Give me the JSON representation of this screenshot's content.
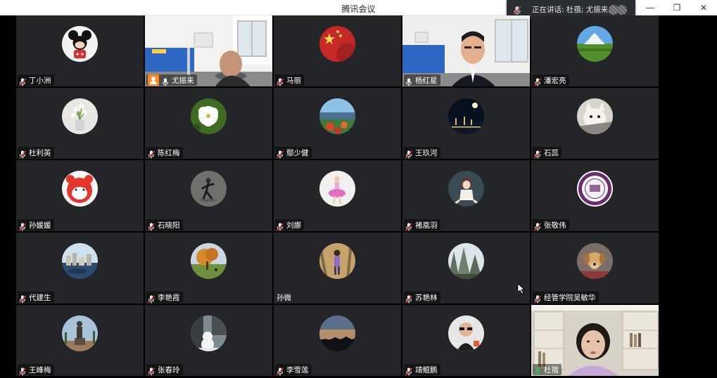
{
  "window": {
    "title": "腾讯会议",
    "speaking_label": "正在讲话: 杜蓓; 尤振来;",
    "controls": {
      "minimize": "—",
      "restore": "❐",
      "close": "✕"
    }
  },
  "colors": {
    "tile_bg": "#242529",
    "speaking_green": "#2fbf55",
    "host_orange": "#ff8a1f",
    "muted_red": "#e53935"
  },
  "participants": [
    {
      "name": "丁小洲",
      "mic": "muted",
      "avatar": "mickey"
    },
    {
      "name": "尤振来",
      "mic": "on",
      "host": true,
      "avatar": "video-room"
    },
    {
      "name": "马丽",
      "mic": "muted",
      "avatar": "flag"
    },
    {
      "name": "杨红星",
      "mic": "on",
      "avatar": "video-man"
    },
    {
      "name": "潘宏亮",
      "mic": "muted",
      "avatar": "mountain"
    },
    {
      "name": "杜利英",
      "mic": "muted",
      "avatar": "flower-vase"
    },
    {
      "name": "陈红梅",
      "mic": "muted",
      "avatar": "white-flower"
    },
    {
      "name": "鄢少健",
      "mic": "muted",
      "avatar": "landscape"
    },
    {
      "name": "王玖河",
      "mic": "muted",
      "avatar": "night"
    },
    {
      "name": "石蕊",
      "mic": "muted",
      "avatar": "cat"
    },
    {
      "name": "孙媛媛",
      "mic": "muted",
      "avatar": "cartoon-red"
    },
    {
      "name": "石晓阳",
      "mic": "muted",
      "avatar": "dancer"
    },
    {
      "name": "刘娜",
      "mic": "muted",
      "avatar": "ballet"
    },
    {
      "name": "褚凰羽",
      "mic": "muted",
      "avatar": "anime-girl"
    },
    {
      "name": "张敬伟",
      "mic": "muted",
      "avatar": "nankai-seal"
    },
    {
      "name": "代建生",
      "mic": "muted",
      "avatar": "city"
    },
    {
      "name": "李艳霞",
      "mic": "muted",
      "avatar": "autumn-tree"
    },
    {
      "name": "孙微",
      "mic": "none",
      "avatar": "child"
    },
    {
      "name": "苏艳林",
      "mic": "muted",
      "avatar": "mountains"
    },
    {
      "name": "经管学院吴敏华",
      "mic": "muted",
      "avatar": "dog"
    },
    {
      "name": "王峰梅",
      "mic": "muted",
      "avatar": "statue"
    },
    {
      "name": "张春玲",
      "mic": "muted",
      "avatar": "snowman"
    },
    {
      "name": "李雪莲",
      "mic": "muted",
      "avatar": "sunset"
    },
    {
      "name": "靖鲲鹏",
      "mic": "muted",
      "avatar": "man-glasses"
    },
    {
      "name": "杜蓓",
      "mic": "speaking",
      "avatar": "video-woman"
    }
  ]
}
